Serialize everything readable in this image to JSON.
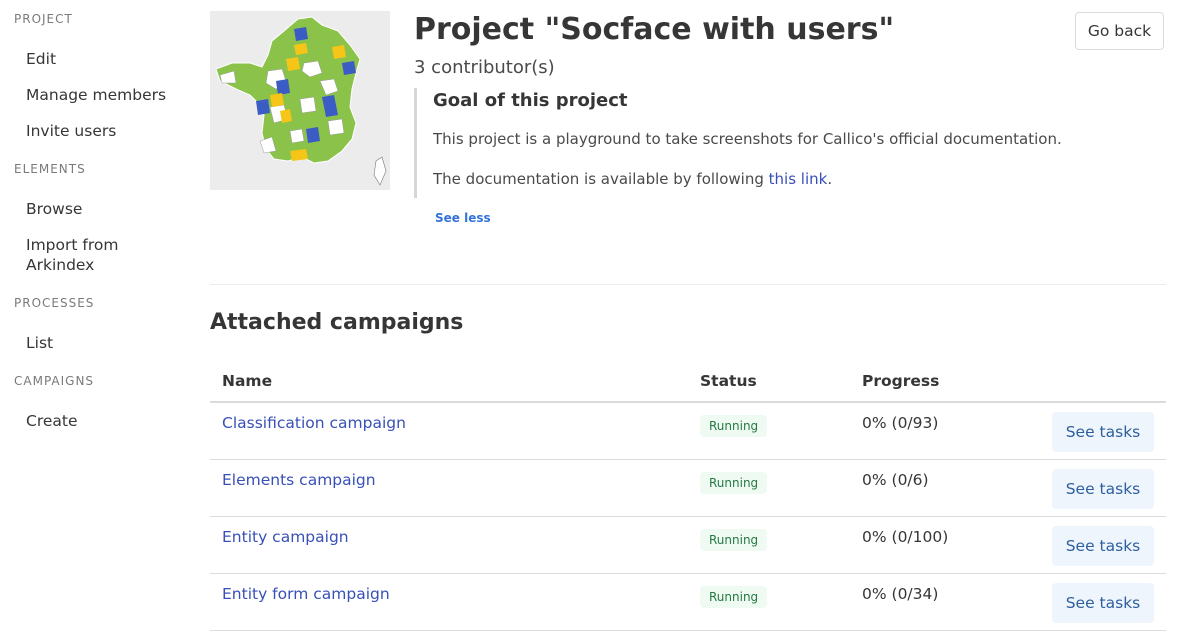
{
  "sidebar": {
    "sections": [
      {
        "title": "PROJECT",
        "items": [
          "Edit",
          "Manage members",
          "Invite users"
        ]
      },
      {
        "title": "ELEMENTS",
        "items": [
          "Browse",
          "Import from Arkindex"
        ]
      },
      {
        "title": "PROCESSES",
        "items": [
          "List"
        ]
      },
      {
        "title": "CAMPAIGNS",
        "items": [
          "Create"
        ]
      }
    ]
  },
  "header": {
    "title": "Project \"Socface with users\"",
    "contributors": "3 contributor(s)",
    "go_back": "Go back"
  },
  "goal": {
    "title": "Goal of this project",
    "paragraph1": "This project is a playground to take screenshots for Callico's official documentation.",
    "paragraph2_before": "The documentation is available by following ",
    "paragraph2_link": "this link",
    "paragraph2_after": ".",
    "toggle": "See less"
  },
  "campaigns": {
    "title": "Attached campaigns",
    "columns": [
      "Name",
      "Status",
      "Progress"
    ],
    "rows": [
      {
        "name": "Classification campaign",
        "status": "Running",
        "progress": "0% (0/93)",
        "action": "See tasks"
      },
      {
        "name": "Elements campaign",
        "status": "Running",
        "progress": "0% (0/6)",
        "action": "See tasks"
      },
      {
        "name": "Entity campaign",
        "status": "Running",
        "progress": "0% (0/100)",
        "action": "See tasks"
      },
      {
        "name": "Entity form campaign",
        "status": "Running",
        "progress": "0% (0/34)",
        "action": "See tasks"
      }
    ]
  },
  "colors": {
    "link": "#3850b7",
    "status_bg": "#effaf3",
    "status_text": "#257942",
    "map_green": "#8bc34a",
    "map_blue": "#3b5cc4",
    "map_yellow": "#f5c518"
  }
}
